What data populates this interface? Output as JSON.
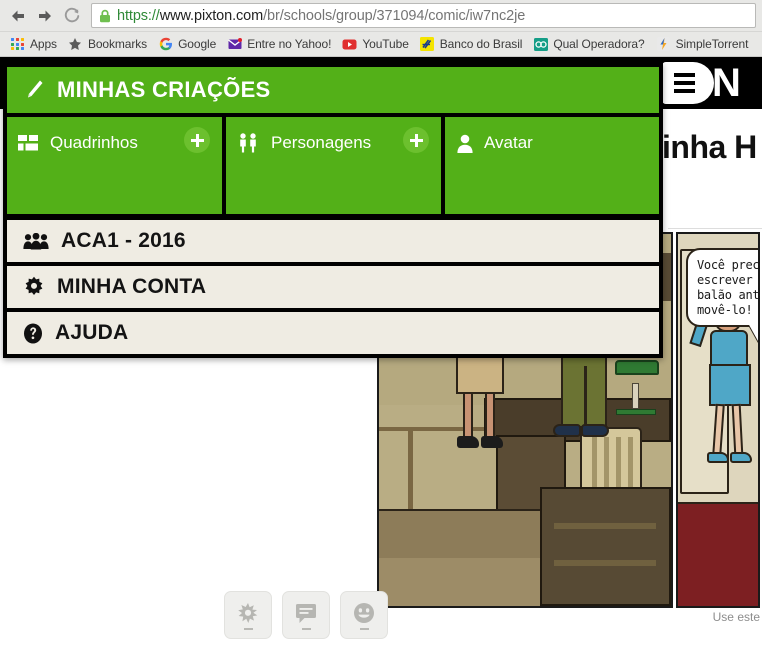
{
  "browser": {
    "back_label": "Back",
    "forward_label": "Forward",
    "reload_label": "Reload",
    "url_scheme": "https://",
    "url_host": "www.pixton.com",
    "url_path": "/br/schools/group/371094/comic/iw7nc2je",
    "url_full": "https://www.pixton.com/br/schools/group/371094/comic/iw7nc2je",
    "bookmarks": [
      {
        "label": "Apps",
        "icon": "apps-grid-icon"
      },
      {
        "label": "Bookmarks",
        "icon": "star-icon"
      },
      {
        "label": "Google",
        "icon": "google-g-icon"
      },
      {
        "label": "Entre no Yahoo!",
        "icon": "yahoo-mail-icon"
      },
      {
        "label": "YouTube",
        "icon": "youtube-icon"
      },
      {
        "label": "Banco do Brasil",
        "icon": "banco-do-brasil-icon"
      },
      {
        "label": "Qual Operadora?",
        "icon": "qual-operadora-icon"
      },
      {
        "label": "SimpleTorrent",
        "icon": "simpletorrent-icon"
      }
    ]
  },
  "app": {
    "brand_letter": "N",
    "hamburger_label": "Menu",
    "comic_title": "inha H"
  },
  "menu": {
    "header": {
      "label": "MINHAS CRIAÇÕES",
      "icon": "pencil-icon"
    },
    "cards": [
      {
        "label": "Quadrinhos",
        "icon": "grid-squares-icon",
        "has_plus": true,
        "plus_label": "+"
      },
      {
        "label": "Personagens",
        "icon": "people-pair-icon",
        "has_plus": true,
        "plus_label": "+"
      },
      {
        "label": "Avatar",
        "icon": "user-silhouette-icon",
        "has_plus": false,
        "plus_label": ""
      }
    ],
    "rows": [
      {
        "label": "ACA1 - 2016",
        "icon": "group-users-icon"
      },
      {
        "label": "MINHA CONTA",
        "icon": "gear-icon"
      },
      {
        "label": "AJUDA",
        "icon": "question-circle-icon"
      }
    ]
  },
  "comic": {
    "bubble_text": "Você precisa\nescrever alg\nbalão antes\nmovê-lo!"
  },
  "toolbar": {
    "buttons": [
      {
        "icon": "splat-effect-icon",
        "label": "-"
      },
      {
        "icon": "speech-bubble-icon",
        "label": "-"
      },
      {
        "icon": "smiley-face-icon",
        "label": "-"
      }
    ]
  },
  "hint": {
    "text": "Use este"
  },
  "colors": {
    "brand_green": "#53b018",
    "plus_green": "#6cc02e",
    "menu_row_bg": "#efece3",
    "chrome_bg": "#e8e8e6"
  }
}
